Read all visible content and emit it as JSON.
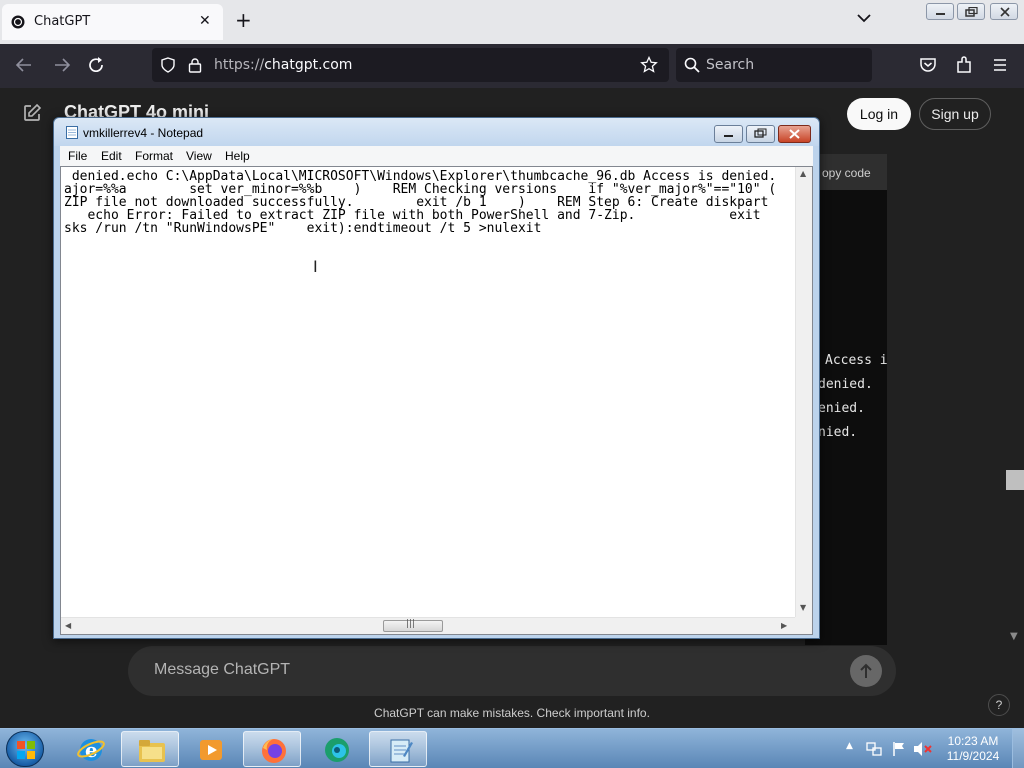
{
  "browser": {
    "tab_title": "ChatGPT",
    "url_protocol": "https://",
    "url_host": "chatgpt.com",
    "search_placeholder": "Search"
  },
  "chatgpt": {
    "model_title": "ChatGPT 4o mini",
    "login_label": "Log in",
    "signup_label": "Sign up",
    "copy_code_label": "opy code",
    "code_lines": [
      "Access i",
      "denied.",
      "enied.",
      "nied."
    ],
    "composer_placeholder": "Message ChatGPT",
    "disclaimer": "ChatGPT can make mistakes. Check important info.",
    "help_label": "?"
  },
  "notepad": {
    "title": "vmkillerrev4 - Notepad",
    "menu": [
      "File",
      "Edit",
      "Format",
      "View",
      "Help"
    ],
    "lines": [
      " denied.echo C:\\AppData\\Local\\MICROSOFT\\Windows\\Explorer\\thumbcache_96.db Access is denied.",
      "ajor=%%a        set ver_minor=%%b    )    REM Checking versions    if \"%ver_major%\"==\"10\" (",
      "ZIP file not downloaded successfully.        exit /b 1    )    REM Step 6: Create diskpart",
      "   echo Error: Failed to extract ZIP file with both PowerShell and 7-Zip.            exit",
      "sks /run /tn \"RunWindowsPE\"    exit):endtimeout /t 5 >nulexit"
    ],
    "hscroll_grip": "|||"
  },
  "taskbar": {
    "time": "10:23 AM",
    "date": "11/9/2024",
    "pinned": [
      "internet-explorer",
      "windows-explorer",
      "windows-media-player",
      "firefox",
      "edge",
      "notepad"
    ]
  },
  "colors": {
    "page_bg": "#212121",
    "browser_nav": "#2b2a33",
    "notepad_frame": "#bcd3ec",
    "taskbar": "#6f9ac8"
  }
}
